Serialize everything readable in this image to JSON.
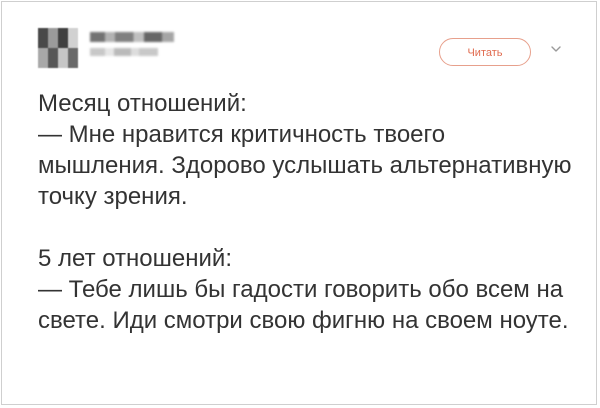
{
  "post": {
    "follow_button_label": "Читать",
    "text": "Месяц отношений:\n— Мне нравится критичность твоего мышления. Здорово услышать альтернативную точку зрения.\n\n5 лет отношений:\n— Тебе лишь бы гадости говорить обо всем на свете. Иди смотри свою фигню на своем ноуте."
  },
  "icons": {
    "menu": "chevron-down-icon"
  },
  "colors": {
    "accent": "#e06b4f",
    "text": "#333333",
    "border": "#cfcfcf"
  }
}
